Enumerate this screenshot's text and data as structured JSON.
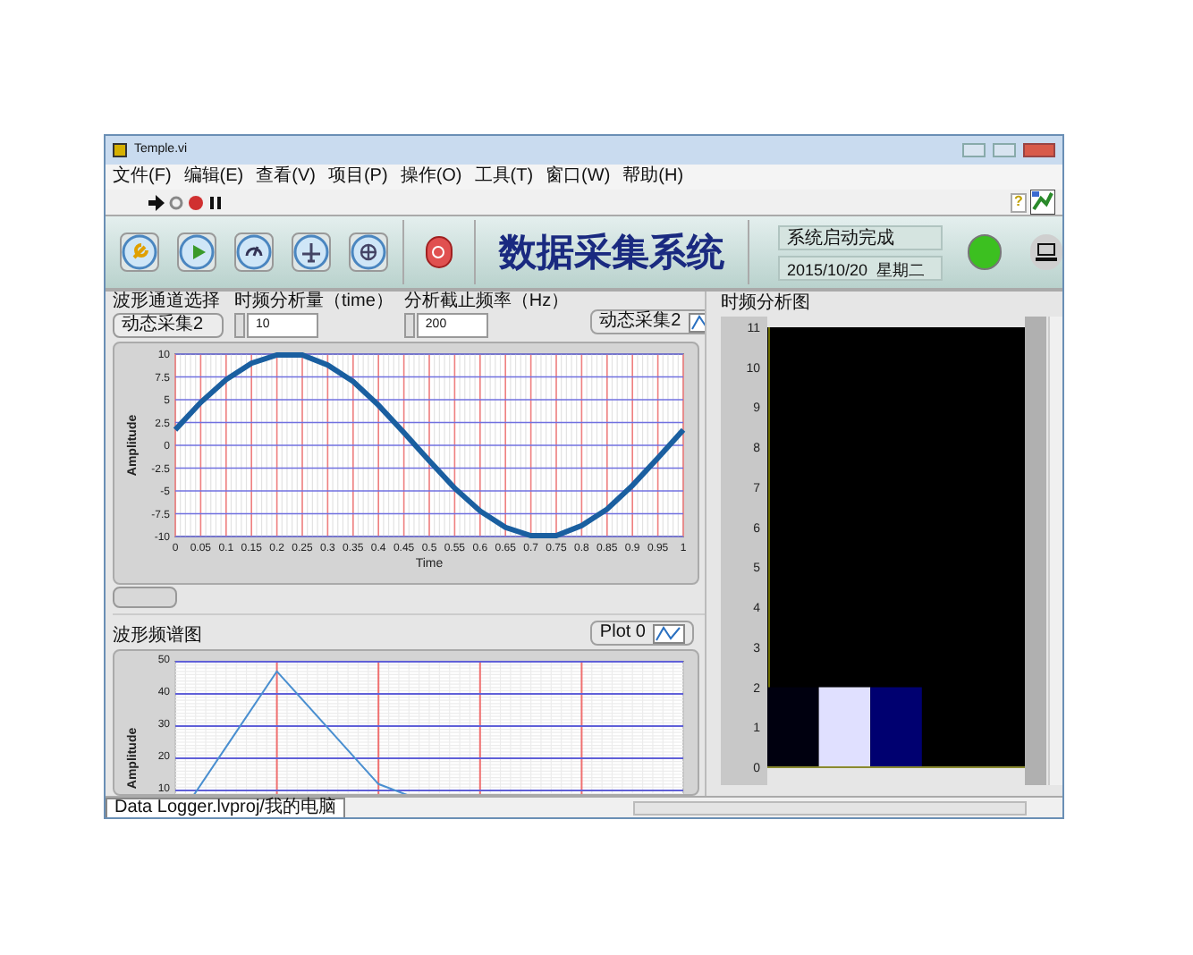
{
  "window": {
    "title": "Temple.vi"
  },
  "menu": [
    "文件(F)",
    "编辑(E)",
    "查看(V)",
    "项目(P)",
    "操作(O)",
    "工具(T)",
    "窗口(W)",
    "帮助(H)"
  ],
  "toolbar": {
    "help": "?"
  },
  "header": {
    "title": "数据采集系统",
    "status_text": "系统启动完成",
    "date": "2015/10/20  星期二",
    "led": {
      "on": true
    }
  },
  "controls": [
    {
      "kind": "ring",
      "label": "波形通道选择",
      "value": "动态采集2"
    },
    {
      "kind": "numeric",
      "label": "时频分析量（time）",
      "value": "10"
    },
    {
      "kind": "numeric",
      "label": "分析截止频率（Hz）",
      "value": "200"
    }
  ],
  "waveform_graph": {
    "chart_data": {
      "type": "line",
      "grid": true,
      "xlabel": "Time",
      "ylabel": "Amplitude",
      "xlim": [
        0,
        1
      ],
      "ylim": [
        -10,
        10
      ],
      "xticks": [
        0,
        {
          "value": 0.05,
          "label": "0.05"
        },
        {
          "value": 0.1,
          "label": "0.1"
        },
        {
          "value": 0.15,
          "label": "0.15"
        },
        {
          "value": 0.2,
          "label": "0.2"
        },
        {
          "value": 0.25,
          "label": "0.25"
        },
        {
          "value": 0.3,
          "label": "0.3"
        },
        {
          "value": 0.35,
          "label": "0.35"
        },
        {
          "value": 0.4,
          "label": "0.4"
        },
        {
          "value": 0.45,
          "label": "0.45"
        },
        {
          "value": 0.5,
          "label": "0.5"
        },
        {
          "value": 0.55,
          "label": "0.55"
        },
        {
          "value": 0.6,
          "label": "0.6"
        },
        {
          "value": 0.65,
          "label": "0.65"
        },
        {
          "value": 0.7,
          "label": "0.7"
        },
        {
          "value": 0.75,
          "label": "0.75"
        },
        {
          "value": 0.8,
          "label": "0.8"
        },
        {
          "value": 0.85,
          "label": "0.85"
        },
        {
          "value": 0.9,
          "label": "0.9"
        },
        {
          "value": 0.95,
          "label": "0.95"
        },
        1
      ],
      "yticks": [
        10,
        7.5,
        5,
        2.5,
        0,
        -2.5,
        -5,
        -7.5,
        -10
      ],
      "x": [
        0,
        0.05,
        0.1,
        0.15,
        0.2,
        0.25,
        0.3,
        0.35,
        0.4,
        0.45,
        0.5,
        0.55,
        0.6,
        0.65,
        0.7,
        0.75,
        0.8,
        0.85,
        0.9,
        0.95,
        1
      ],
      "series": [
        {
          "name": "动态采集2",
          "color": "#1a5fa0",
          "values": [
            1.7,
            4.7,
            7.2,
            9,
            9.9,
            9.9,
            8.8,
            7,
            4.4,
            1.4,
            -1.7,
            -4.7,
            -7.2,
            -9,
            -9.9,
            -9.9,
            -8.8,
            -7,
            -4.4,
            -1.4,
            1.7
          ]
        }
      ]
    }
  },
  "spectrum_graph": {
    "label": "波形频谱图",
    "chart_data": {
      "type": "line",
      "grid": true,
      "ylabel": "Amplitude",
      "ylim": [
        0,
        50
      ],
      "yticks": [
        10,
        20,
        30,
        40,
        50
      ],
      "series": [
        {
          "name": "Plot 0",
          "color": "#4a8fd0",
          "values": [
            0,
            47,
            12,
            0
          ]
        }
      ]
    }
  },
  "intensity_graph": {
    "label": "时频分析图",
    "chart_data": {
      "type": "bar",
      "categories": [
        null,
        null,
        null,
        null,
        null
      ],
      "ylim": [
        0,
        11
      ],
      "yticks": [
        0,
        1,
        2,
        3,
        4,
        5,
        6,
        7,
        8,
        9,
        10,
        11
      ],
      "series": [
        {
          "color": "#00000f",
          "values": [
            2,
            null,
            null,
            null,
            null
          ]
        },
        {
          "color": "#e0e0ff",
          "values": [
            null,
            2,
            null,
            null,
            null
          ]
        },
        {
          "color": "#000070",
          "values": [
            null,
            null,
            2,
            null,
            null
          ]
        }
      ]
    }
  },
  "status_bar": {
    "path": "Data Logger.lvproj/我的电脑"
  }
}
